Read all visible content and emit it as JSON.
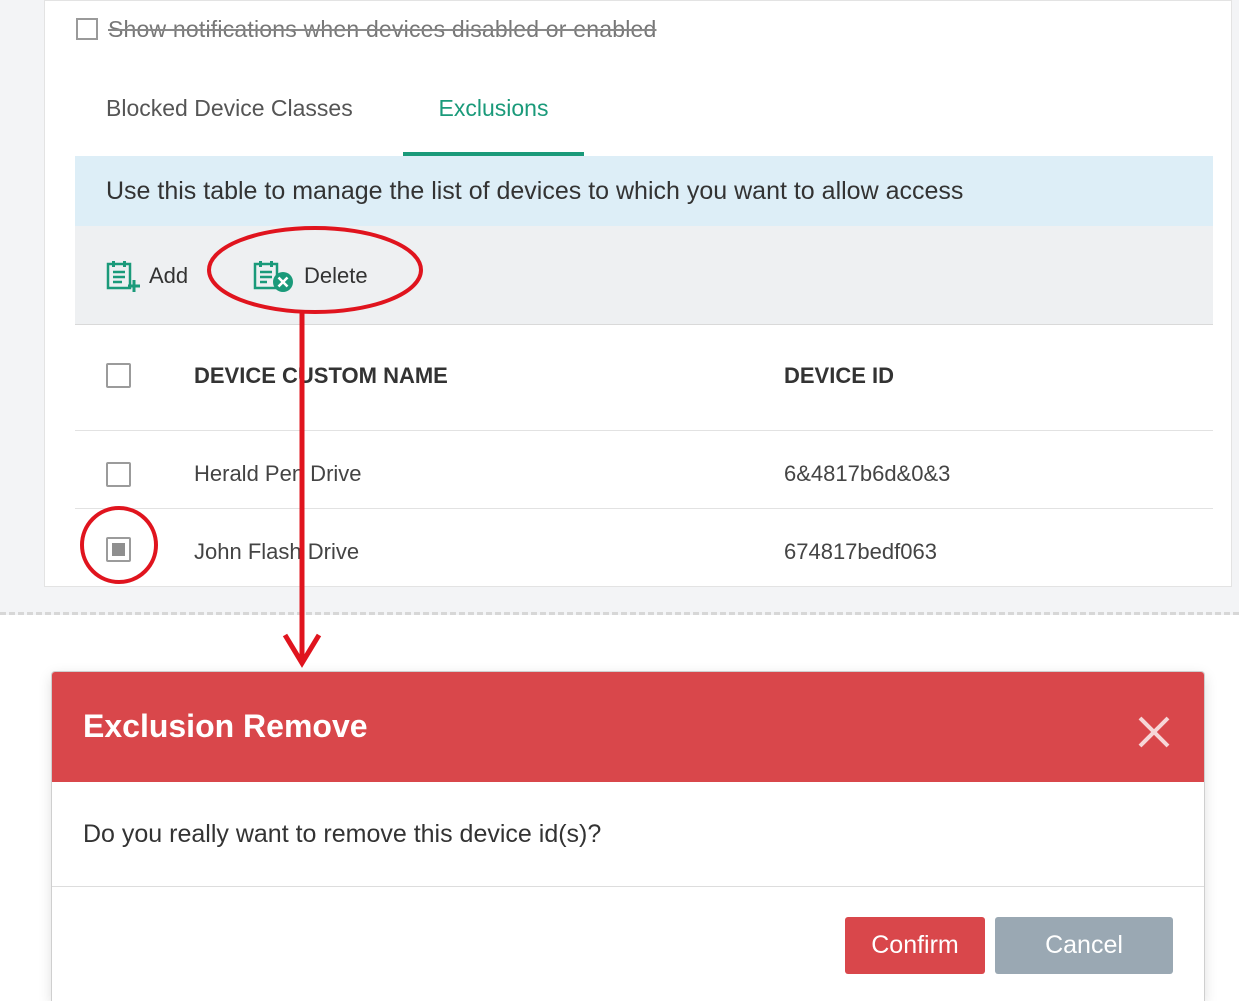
{
  "notification": {
    "label": "Show notifications when devices disabled or enabled"
  },
  "tabs": [
    {
      "label": "Blocked Device Classes",
      "active": false
    },
    {
      "label": "Exclusions",
      "active": true
    }
  ],
  "info_bar": {
    "text": "Use this table to manage the list of devices to which you want to allow access"
  },
  "toolbar": {
    "add_label": "Add",
    "delete_label": "Delete"
  },
  "table": {
    "columns": [
      "DEVICE CUSTOM NAME",
      "DEVICE ID"
    ],
    "rows": [
      {
        "name": "Herald Pen Drive",
        "device_id": "6&4817b6d&0&3",
        "selected": false
      },
      {
        "name": "John Flash Drive",
        "device_id": "674817bedf063",
        "selected": true
      }
    ]
  },
  "dialog": {
    "title": "Exclusion Remove",
    "message": "Do you really want to remove this device id(s)?",
    "confirm_label": "Confirm",
    "cancel_label": "Cancel",
    "header_color": "#d9474b"
  },
  "colors": {
    "accent": "#1a9a7a",
    "annotation": "#e0141e",
    "info_bar": "#ddeef7"
  },
  "icons": {
    "add": "list-add-icon",
    "delete": "list-delete-icon",
    "close": "close-icon"
  }
}
